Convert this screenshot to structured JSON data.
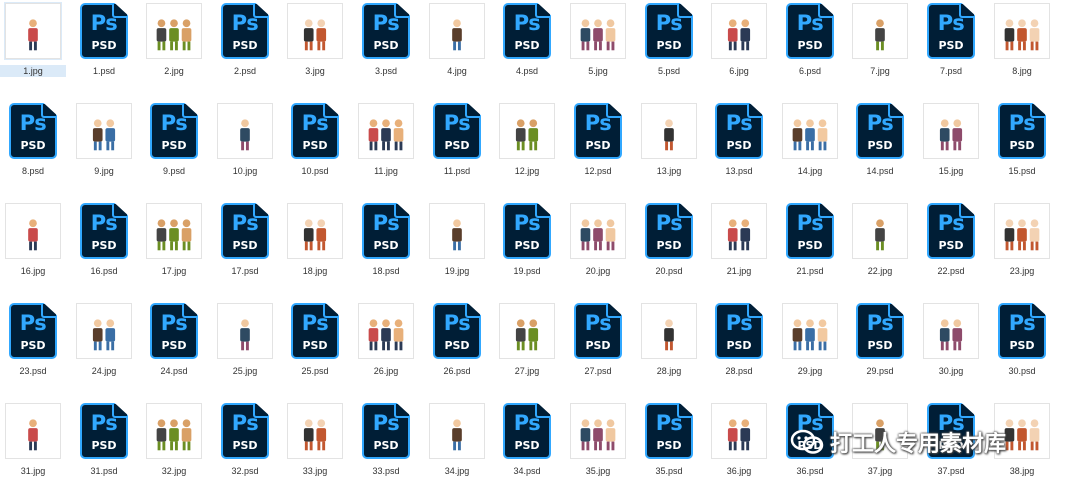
{
  "files": [
    {
      "name": "1.jpg",
      "type": "jpg",
      "selected": true
    },
    {
      "name": "1.psd",
      "type": "psd"
    },
    {
      "name": "2.jpg",
      "type": "jpg"
    },
    {
      "name": "2.psd",
      "type": "psd"
    },
    {
      "name": "3.jpg",
      "type": "jpg"
    },
    {
      "name": "3.psd",
      "type": "psd"
    },
    {
      "name": "4.jpg",
      "type": "jpg"
    },
    {
      "name": "4.psd",
      "type": "psd"
    },
    {
      "name": "5.jpg",
      "type": "jpg"
    },
    {
      "name": "5.psd",
      "type": "psd"
    },
    {
      "name": "6.jpg",
      "type": "jpg"
    },
    {
      "name": "6.psd",
      "type": "psd"
    },
    {
      "name": "7.jpg",
      "type": "jpg"
    },
    {
      "name": "7.psd",
      "type": "psd"
    },
    {
      "name": "8.jpg",
      "type": "jpg"
    },
    {
      "name": "8.psd",
      "type": "psd"
    },
    {
      "name": "9.jpg",
      "type": "jpg"
    },
    {
      "name": "9.psd",
      "type": "psd"
    },
    {
      "name": "10.jpg",
      "type": "jpg"
    },
    {
      "name": "10.psd",
      "type": "psd"
    },
    {
      "name": "11.jpg",
      "type": "jpg"
    },
    {
      "name": "11.psd",
      "type": "psd"
    },
    {
      "name": "12.jpg",
      "type": "jpg"
    },
    {
      "name": "12.psd",
      "type": "psd"
    },
    {
      "name": "13.jpg",
      "type": "jpg"
    },
    {
      "name": "13.psd",
      "type": "psd"
    },
    {
      "name": "14.jpg",
      "type": "jpg"
    },
    {
      "name": "14.psd",
      "type": "psd"
    },
    {
      "name": "15.jpg",
      "type": "jpg"
    },
    {
      "name": "15.psd",
      "type": "psd"
    },
    {
      "name": "16.jpg",
      "type": "jpg"
    },
    {
      "name": "16.psd",
      "type": "psd"
    },
    {
      "name": "17.jpg",
      "type": "jpg"
    },
    {
      "name": "17.psd",
      "type": "psd"
    },
    {
      "name": "18.jpg",
      "type": "jpg"
    },
    {
      "name": "18.psd",
      "type": "psd"
    },
    {
      "name": "19.jpg",
      "type": "jpg"
    },
    {
      "name": "19.psd",
      "type": "psd"
    },
    {
      "name": "20.jpg",
      "type": "jpg"
    },
    {
      "name": "20.psd",
      "type": "psd"
    },
    {
      "name": "21.jpg",
      "type": "jpg"
    },
    {
      "name": "21.psd",
      "type": "psd"
    },
    {
      "name": "22.jpg",
      "type": "jpg"
    },
    {
      "name": "22.psd",
      "type": "psd"
    },
    {
      "name": "23.jpg",
      "type": "jpg"
    },
    {
      "name": "23.psd",
      "type": "psd"
    },
    {
      "name": "24.jpg",
      "type": "jpg"
    },
    {
      "name": "24.psd",
      "type": "psd"
    },
    {
      "name": "25.jpg",
      "type": "jpg"
    },
    {
      "name": "25.psd",
      "type": "psd"
    },
    {
      "name": "26.jpg",
      "type": "jpg"
    },
    {
      "name": "26.psd",
      "type": "psd"
    },
    {
      "name": "27.jpg",
      "type": "jpg"
    },
    {
      "name": "27.psd",
      "type": "psd"
    },
    {
      "name": "28.jpg",
      "type": "jpg"
    },
    {
      "name": "28.psd",
      "type": "psd"
    },
    {
      "name": "29.jpg",
      "type": "jpg"
    },
    {
      "name": "29.psd",
      "type": "psd"
    },
    {
      "name": "30.jpg",
      "type": "jpg"
    },
    {
      "name": "30.psd",
      "type": "psd"
    },
    {
      "name": "31.jpg",
      "type": "jpg"
    },
    {
      "name": "31.psd",
      "type": "psd"
    },
    {
      "name": "32.jpg",
      "type": "jpg"
    },
    {
      "name": "32.psd",
      "type": "psd"
    },
    {
      "name": "33.jpg",
      "type": "jpg"
    },
    {
      "name": "33.psd",
      "type": "psd"
    },
    {
      "name": "34.jpg",
      "type": "jpg"
    },
    {
      "name": "34.psd",
      "type": "psd"
    },
    {
      "name": "35.jpg",
      "type": "jpg"
    },
    {
      "name": "35.psd",
      "type": "psd"
    },
    {
      "name": "36.jpg",
      "type": "jpg"
    },
    {
      "name": "36.psd",
      "type": "psd"
    },
    {
      "name": "37.jpg",
      "type": "jpg"
    },
    {
      "name": "37.psd",
      "type": "psd"
    },
    {
      "name": "38.jpg",
      "type": "jpg"
    }
  ],
  "psd_icon": {
    "logo_text": "Ps",
    "format_text": "PSD"
  },
  "watermark": {
    "text": "打工人专用素材库",
    "icon": "wechat-icon"
  },
  "colors": {
    "psd_background": "#001e36",
    "psd_accent": "#31a8ff",
    "selection": "#dbeaf8"
  }
}
